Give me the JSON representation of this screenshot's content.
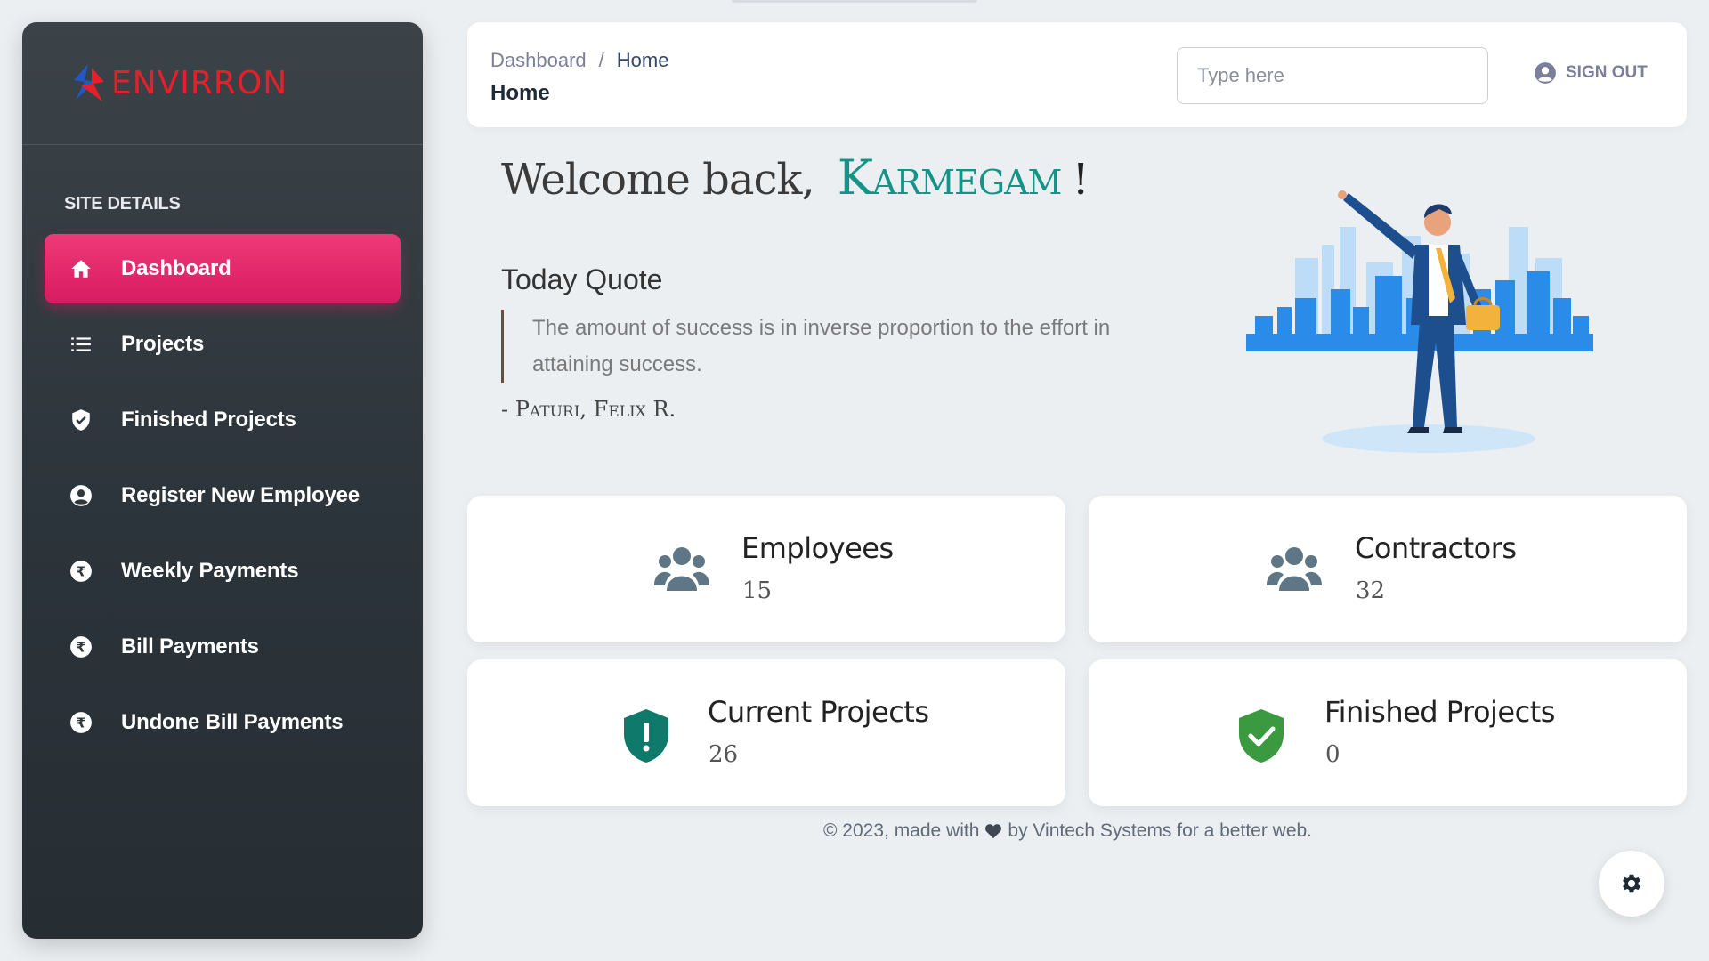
{
  "brand": {
    "name": "ENVIRRON"
  },
  "sidebar": {
    "section_title": "SITE DETAILS",
    "items": [
      {
        "label": "Dashboard",
        "icon": "home-icon",
        "active": true
      },
      {
        "label": "Projects",
        "icon": "list-icon"
      },
      {
        "label": "Finished Projects",
        "icon": "shield-check-icon"
      },
      {
        "label": "Register New Employee",
        "icon": "user-circle-icon"
      },
      {
        "label": "Weekly Payments",
        "icon": "rupee-icon"
      },
      {
        "label": "Bill Payments",
        "icon": "rupee-icon"
      },
      {
        "label": "Undone Bill Payments",
        "icon": "rupee-icon"
      }
    ]
  },
  "header": {
    "breadcrumb_root": "Dashboard",
    "breadcrumb_separator": "/",
    "breadcrumb_current": "Home",
    "page_title": "Home",
    "search_placeholder": "Type here",
    "signout_label": "SIGN OUT"
  },
  "welcome": {
    "greeting": "Welcome back,",
    "name": "Karmegam",
    "exclamation": "!"
  },
  "quote": {
    "heading": "Today Quote",
    "text": "The amount of success is in inverse proportion to the effort in attaining success.",
    "author": "- Paturi, Felix R."
  },
  "stats": [
    {
      "title": "Employees",
      "value": "15",
      "icon": "users-icon",
      "color": "#5f7686"
    },
    {
      "title": "Contractors",
      "value": "32",
      "icon": "users-icon",
      "color": "#5f7686"
    },
    {
      "title": "Current Projects",
      "value": "26",
      "icon": "shield-alert-icon",
      "color": "#0f7a6c"
    },
    {
      "title": "Finished Projects",
      "value": "0",
      "icon": "shield-check-icon",
      "color": "#3b9a3f"
    }
  ],
  "footer": {
    "prefix": "© 2023, made with",
    "suffix": "by Vintech Systems for a better web."
  },
  "colors": {
    "accent": "#e91e63",
    "sidebar_bg": "#2f373e",
    "brand_red": "#e5202a",
    "name_teal": "#139486"
  }
}
